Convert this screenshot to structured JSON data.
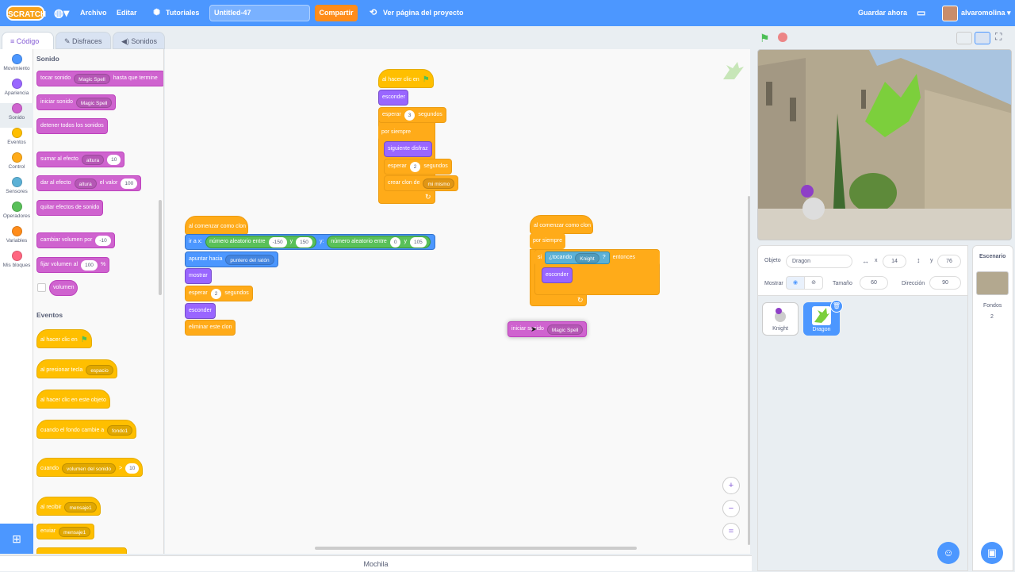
{
  "menu": {
    "file": "Archivo",
    "edit": "Editar",
    "tutorials": "Tutoriales",
    "project_title": "Untitled-47",
    "share": "Compartir",
    "see_project": "Ver página del proyecto",
    "save_now": "Guardar ahora",
    "username": "alvaromolina"
  },
  "tabs": {
    "code": "Código",
    "costumes": "Disfraces",
    "sounds": "Sonidos"
  },
  "categories": [
    "Movimiento",
    "Apariencia",
    "Sonido",
    "Eventos",
    "Control",
    "Sensores",
    "Operadores",
    "Variables",
    "Mis bloques"
  ],
  "palette": {
    "sound_head": "Sonido",
    "play_until": "tocar sonido",
    "play_until_opt": "Magic Spell",
    "play_until_tail": "hasta que termine",
    "start_sound": "iniciar sonido",
    "start_sound_opt": "Magic Spell",
    "stop_all": "detener todos los sonidos",
    "change_effect": "sumar al efecto",
    "change_effect_opt": "altura",
    "change_effect_val": "10",
    "set_effect": "dar al efecto",
    "set_effect_opt": "altura",
    "set_effect_mid": "el valor",
    "set_effect_val": "100",
    "clear_effects": "quitar efectos de sonido",
    "change_vol": "cambiar volumen por",
    "change_vol_val": "-10",
    "set_vol": "fijar volumen al",
    "set_vol_val": "100",
    "set_vol_unit": "%",
    "volume": "volumen",
    "events_head": "Eventos",
    "when_flag": "al hacer clic en",
    "when_key": "al presionar tecla",
    "when_key_opt": "espacio",
    "when_sprite": "al hacer clic en este objeto",
    "when_backdrop": "cuando el fondo cambie a",
    "when_backdrop_opt": "fondo1",
    "when_gt": "cuando",
    "when_gt_opt": "volumen del sonido",
    "when_gt_op": ">",
    "when_gt_val": "10",
    "when_receive": "al recibir",
    "when_receive_opt": "mensaje1",
    "broadcast": "enviar",
    "broadcast_opt": "mensaje1"
  },
  "script1": {
    "hat": "al hacer clic en",
    "hide": "esconder",
    "wait": "esperar",
    "wait_val": "3",
    "secs": "segundos",
    "forever": "por siempre",
    "next_costume": "siguiente disfraz",
    "wait2": "esperar",
    "wait2_val": "2",
    "secs2": "segundos",
    "clone": "crear clon de",
    "clone_opt": "mi mismo"
  },
  "script2": {
    "hat": "al comenzar como clon",
    "goto": "ir a x:",
    "rand1": "número aleatorio entre",
    "r1a": "-150",
    "y1": "y",
    "r1b": "150",
    "ylabel": "y:",
    "rand2": "número aleatorio entre",
    "r2a": "0",
    "y2": "y",
    "r2b": "105",
    "point": "apuntar hacia",
    "point_opt": "puntero del ratón",
    "show": "mostrar",
    "wait": "esperar",
    "wait_val": "2",
    "secs": "segundos",
    "hide": "esconder",
    "delete": "eliminar este clon"
  },
  "script3": {
    "hat": "al comenzar como clon",
    "forever": "por siempre",
    "if": "si",
    "touching": "¿tocando",
    "touching_opt": "Knight",
    "q": "?",
    "then": "entonces",
    "hide": "esconder"
  },
  "floating": {
    "label": "iniciar sonido",
    "opt": "Magic Spell"
  },
  "zoom": {
    "in": "+",
    "out": "−",
    "reset": "="
  },
  "backpack": "Mochila",
  "sprite": {
    "object_label": "Objeto",
    "name": "Dragon",
    "x_label": "x",
    "x": "14",
    "y_label": "y",
    "y": "76",
    "show_label": "Mostrar",
    "size_label": "Tamaño",
    "size": "60",
    "dir_label": "Dirección",
    "dir": "90"
  },
  "sprites": [
    {
      "name": "Knight"
    },
    {
      "name": "Dragon"
    }
  ],
  "stage_panel": {
    "title": "Escenario",
    "backdrops_label": "Fondos",
    "backdrops_count": "2"
  },
  "colors": {
    "accent": "#4c97ff",
    "sound": "#cf63cf",
    "events": "#ffbf00",
    "control": "#ffab19",
    "looks": "#9966ff",
    "motion": "#4c97ff",
    "operators": "#59c059",
    "sensing": "#5cb1d6"
  },
  "icons": [
    "globe-icon",
    "bulb-icon",
    "remix-icon",
    "folder-icon",
    "green-flag-icon",
    "stop-icon",
    "zoom-in-icon",
    "zoom-out-icon",
    "zoom-reset-icon",
    "eye-icon",
    "eye-off-icon",
    "trash-icon",
    "add-sprite-icon",
    "add-backdrop-icon",
    "extension-icon"
  ]
}
